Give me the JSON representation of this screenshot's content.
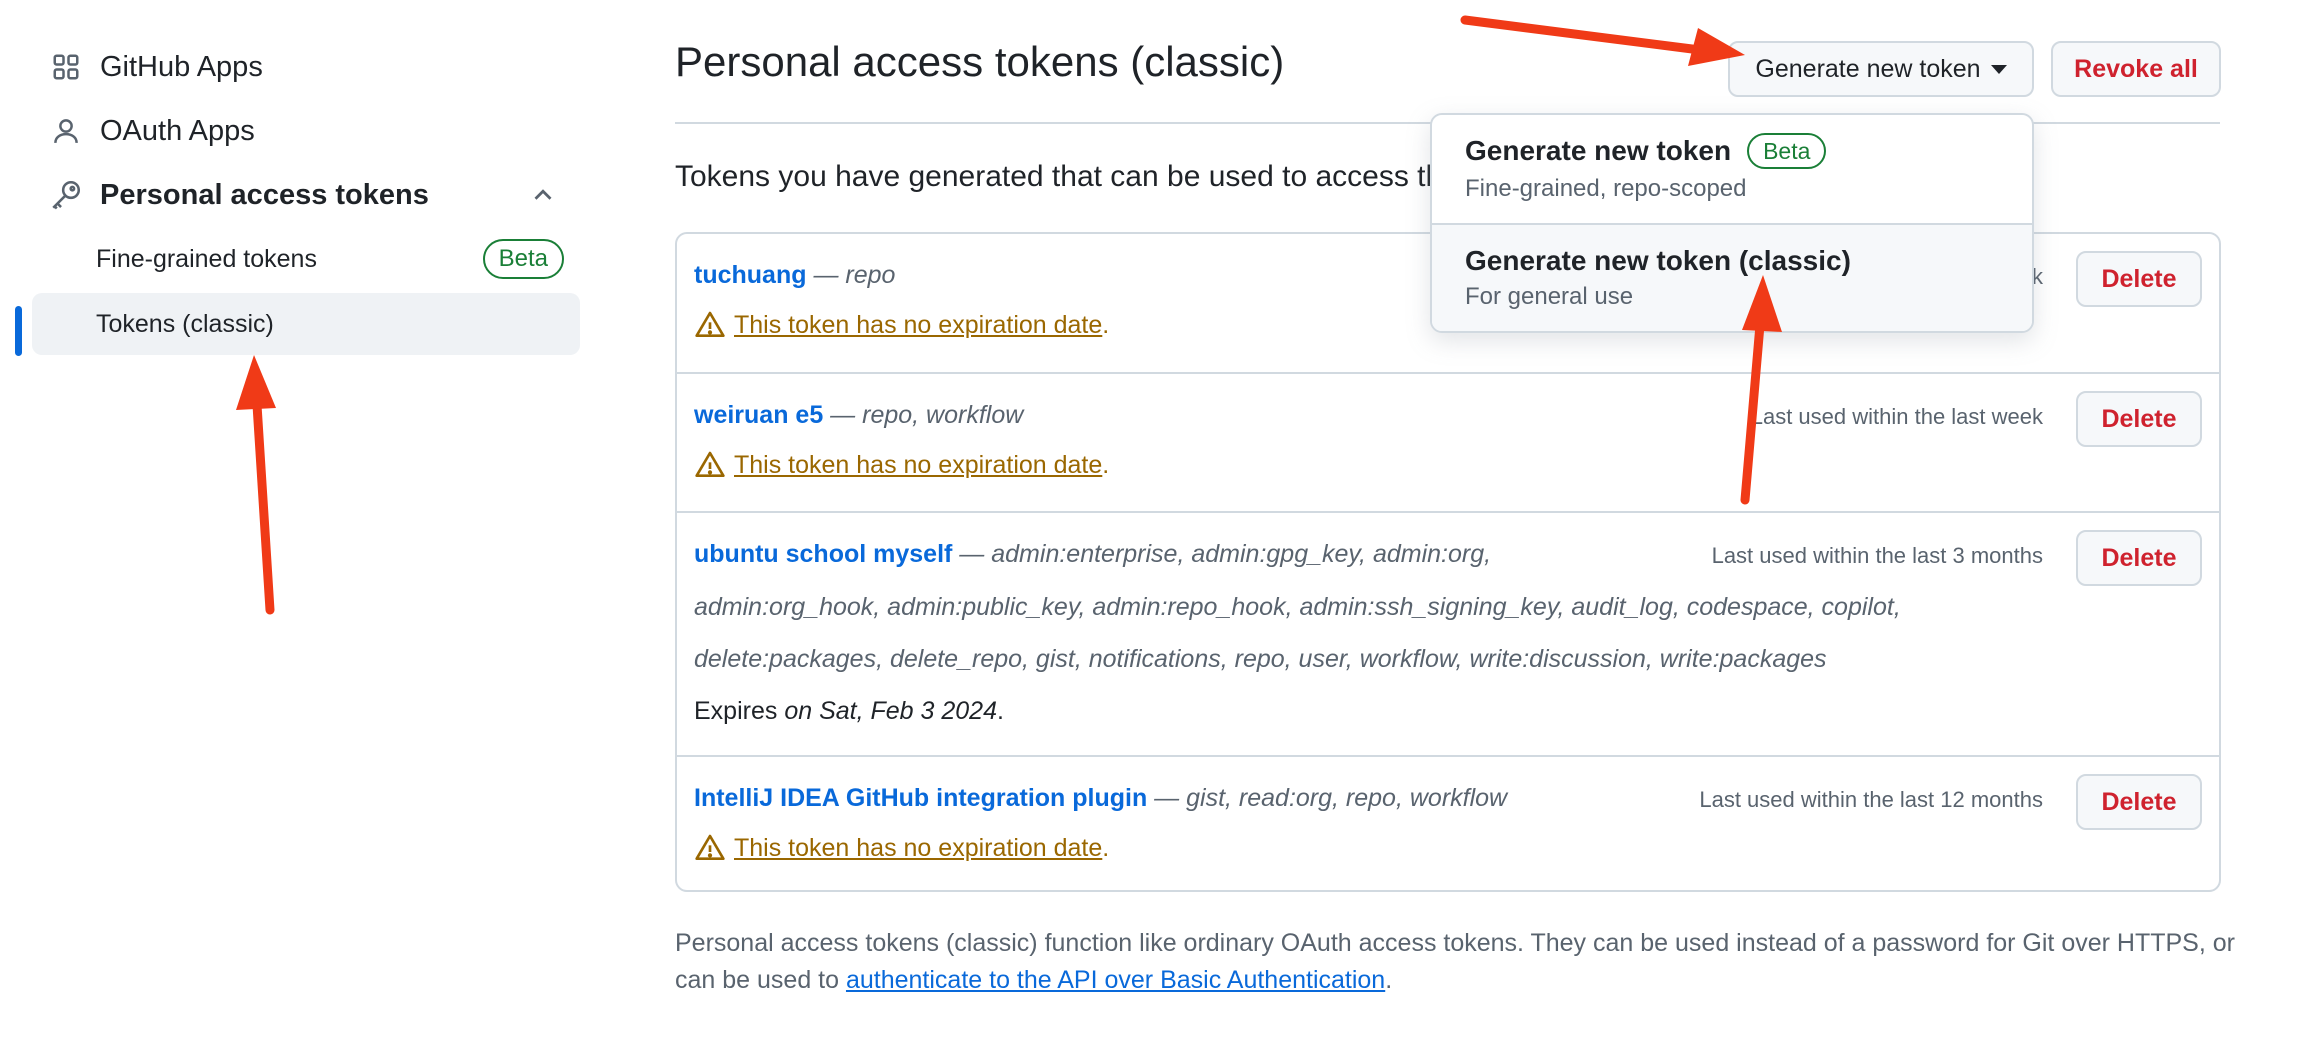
{
  "sidebar": {
    "items": [
      {
        "label": "GitHub Apps"
      },
      {
        "label": "OAuth Apps"
      },
      {
        "label": "Personal access tokens"
      }
    ],
    "sub_items": [
      {
        "label": "Fine-grained tokens",
        "badge": "Beta"
      },
      {
        "label": "Tokens (classic)"
      }
    ]
  },
  "header": {
    "title": "Personal access tokens (classic)",
    "generate_label": "Generate new token",
    "revoke_label": "Revoke all"
  },
  "intro": "Tokens you have generated that can be used to access the",
  "dropdown": {
    "items": [
      {
        "title": "Generate new token",
        "badge": "Beta",
        "desc": "Fine-grained, repo-scoped"
      },
      {
        "title": "Generate new token (classic)",
        "desc": "For general use"
      }
    ]
  },
  "tokens": [
    {
      "name": "tuchuang",
      "scopes": " — repo",
      "warning": "This token has no expiration date",
      "last_used": "k",
      "delete_label": "Delete"
    },
    {
      "name": "weiruan e5",
      "scopes": " — repo, workflow",
      "warning": "This token has no expiration date",
      "last_used": "Last used within the last week",
      "delete_label": "Delete"
    },
    {
      "name": "ubuntu school myself",
      "scopes_line1": " — admin:enterprise, admin:gpg_key, admin:org,",
      "scopes_line2": "admin:org_hook, admin:public_key, admin:repo_hook, admin:ssh_signing_key, audit_log, codespace, copilot,",
      "scopes_line3": "delete:packages, delete_repo, gist, notifications, repo, user, workflow, write:discussion, write:packages",
      "expires_prefix": "Expires ",
      "expires_date": "on Sat, Feb 3 2024",
      "last_used": "Last used within the last 3 months",
      "delete_label": "Delete"
    },
    {
      "name": "IntelliJ IDEA GitHub integration plugin",
      "scopes": " — gist, read:org, repo, workflow",
      "warning": "This token has no expiration date",
      "last_used": "Last used within the last 12 months",
      "delete_label": "Delete"
    }
  ],
  "footnote": {
    "text": "Personal access tokens (classic) function like ordinary OAuth access tokens. They can be used instead of a password for Git over HTTPS, or can be used to ",
    "link": "authenticate to the API over Basic Authentication",
    "end": "."
  },
  "colors": {
    "link": "#0969da",
    "danger": "#cf222e",
    "warning": "#9a6700",
    "success": "#1a7f37",
    "annotation_arrow": "#f03a17"
  },
  "icons": [
    "apps-grid-icon",
    "person-icon",
    "key-icon",
    "chevron-up-icon",
    "caret-down-icon",
    "alert-triangle-icon"
  ]
}
